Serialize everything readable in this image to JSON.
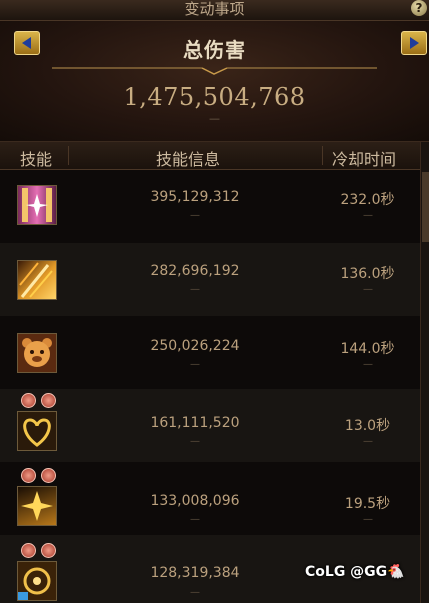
{
  "window": {
    "title": "变动事项",
    "help": "?"
  },
  "summary": {
    "label": "总伤害",
    "total": "1,475,504,768",
    "dash": "—"
  },
  "columns": {
    "skill": "技能",
    "info": "技能信息",
    "cooldown": "冷却时间"
  },
  "rows": [
    {
      "icon": "pink-pillar-skill-icon",
      "damage": "395,129,312",
      "cooldown": "232.0秒",
      "dash": "—"
    },
    {
      "icon": "golden-slash-skill-icon",
      "damage": "282,696,192",
      "cooldown": "136.0秒",
      "dash": "—"
    },
    {
      "icon": "bear-skill-icon",
      "damage": "250,026,224",
      "cooldown": "144.0秒",
      "dash": "—"
    },
    {
      "icon": "golden-heart-skill-icon",
      "damage": "161,111,520",
      "cooldown": "13.0秒",
      "dash": "—"
    },
    {
      "icon": "golden-burst-skill-icon",
      "damage": "133,008,096",
      "cooldown": "19.5秒",
      "dash": "—"
    },
    {
      "icon": "golden-rune-skill-icon",
      "damage": "128,319,384",
      "cooldown": "",
      "dash": "—"
    }
  ],
  "watermark": "CoLG @GG🐔",
  "colors": {
    "accent": "#d9b44a",
    "text": "#bba17e",
    "arrow": "#1d3c9c"
  }
}
